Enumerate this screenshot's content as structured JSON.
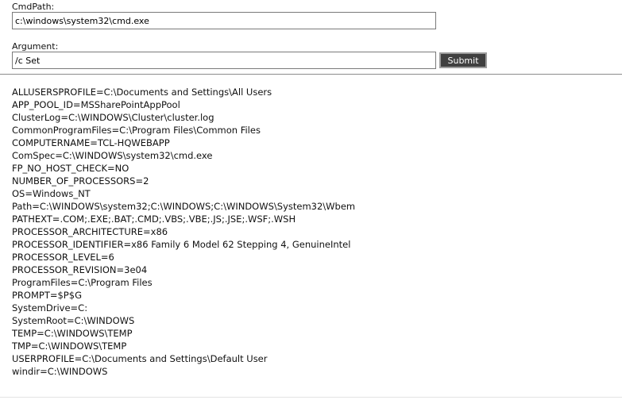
{
  "form": {
    "cmdpath_label": "CmdPath:",
    "cmdpath_value": "c:\\windows\\system32\\cmd.exe",
    "argument_label": "Argument:",
    "argument_value": "/c Set",
    "submit_label": "Submit"
  },
  "output": {
    "lines": [
      "ALLUSERSPROFILE=C:\\Documents and Settings\\All Users",
      "APP_POOL_ID=MSSharePointAppPool",
      "ClusterLog=C:\\WINDOWS\\Cluster\\cluster.log",
      "CommonProgramFiles=C:\\Program Files\\Common Files",
      "COMPUTERNAME=TCL-HQWEBAPP",
      "ComSpec=C:\\WINDOWS\\system32\\cmd.exe",
      "FP_NO_HOST_CHECK=NO",
      "NUMBER_OF_PROCESSORS=2",
      "OS=Windows_NT",
      "Path=C:\\WINDOWS\\system32;C:\\WINDOWS;C:\\WINDOWS\\System32\\Wbem",
      "PATHEXT=.COM;.EXE;.BAT;.CMD;.VBS;.VBE;.JS;.JSE;.WSF;.WSH",
      "PROCESSOR_ARCHITECTURE=x86",
      "PROCESSOR_IDENTIFIER=x86 Family 6 Model 62 Stepping 4, GenuineIntel",
      "PROCESSOR_LEVEL=6",
      "PROCESSOR_REVISION=3e04",
      "ProgramFiles=C:\\Program Files",
      "PROMPT=$P$G",
      "SystemDrive=C:",
      "SystemRoot=C:\\WINDOWS",
      "TEMP=C:\\WINDOWS\\TEMP",
      "TMP=C:\\WINDOWS\\TEMP",
      "USERPROFILE=C:\\Documents and Settings\\Default User",
      "windir=C:\\WINDOWS"
    ]
  }
}
